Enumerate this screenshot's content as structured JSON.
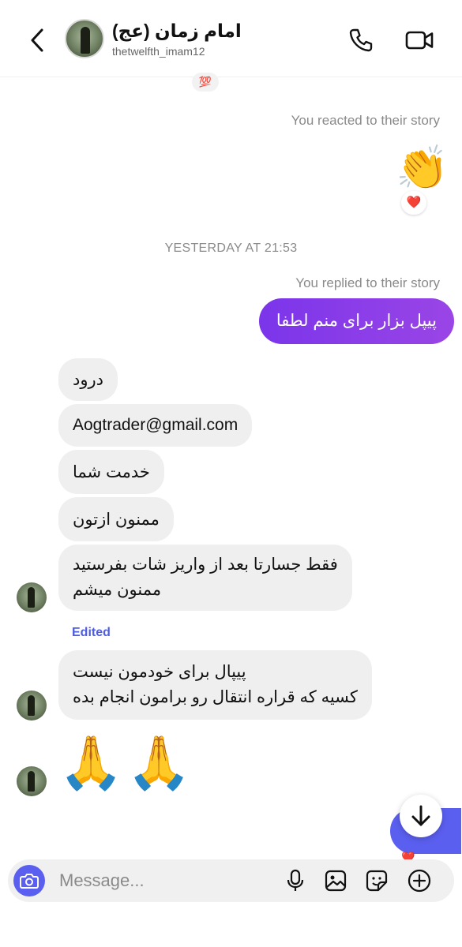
{
  "header": {
    "name": "امام زمان (عج)",
    "handle": "thetwelfth_imam12"
  },
  "chat": {
    "hundred_emoji": "💯",
    "reacted_label": "You reacted to their story",
    "clap_emoji": "👏",
    "reaction_heart": "❤️",
    "timestamp": "YESTERDAY AT 21:53",
    "replied_label": "You replied to their story",
    "outgoing_message": "پیپل بزار برای منم لطفا",
    "incoming": [
      {
        "lines": [
          "درود"
        ]
      },
      {
        "lines": [
          "Aogtrader@gmail.com"
        ]
      },
      {
        "lines": [
          "خدمت شما"
        ]
      },
      {
        "lines": [
          "ممنون ازتون"
        ]
      },
      {
        "lines": [
          "فقط جسارتا بعد از واریز شات بفرستید",
          "ممنون میشم"
        ]
      },
      {
        "lines": [
          "پیپال برای خودمون نیست",
          "کسیه که قراره انتقال رو برامون انجام بده"
        ]
      }
    ],
    "edited_label": "Edited",
    "pray_emoji": "🙏🙏",
    "peek_heart": "❤️"
  },
  "composer": {
    "placeholder": "Message..."
  },
  "icons": {
    "back": "chevron-left-icon",
    "call": "phone-icon",
    "video": "video-camera-icon",
    "camera": "camera-icon",
    "mic": "microphone-icon",
    "gallery": "image-icon",
    "sticker": "sticker-icon",
    "add": "plus-icon",
    "scroll": "arrow-down-icon"
  },
  "colors": {
    "outgoing_bubble": "#8a3ee8",
    "accent": "#5b5ff0",
    "incoming_bubble": "#efefef",
    "edited": "#4e5ce0"
  }
}
